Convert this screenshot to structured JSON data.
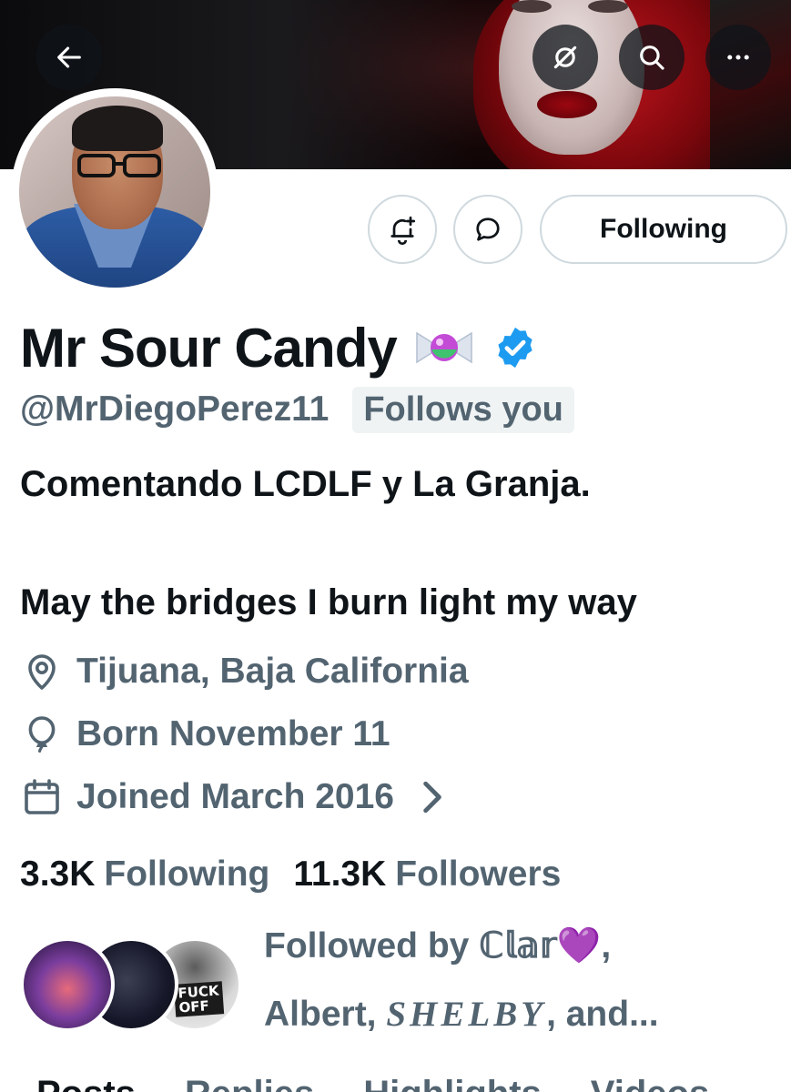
{
  "header": {
    "back_icon": "arrow-left-icon",
    "grok_icon": "grok-slash-icon",
    "search_icon": "search-icon",
    "more_icon": "more-horizontal-icon"
  },
  "actions": {
    "notify_icon": "bell-plus-icon",
    "message_icon": "message-bubble-icon",
    "following_label": "Following"
  },
  "profile": {
    "name": "Mr Sour Candy",
    "name_emoji": "candy-emoji",
    "verified_icon": "verified-badge-icon",
    "handle": "@MrDiegoPerez11",
    "follows_you": "Follows you",
    "bio_line1": "Comentando LCDLF y La Granja.",
    "bio_line2": "May the bridges I burn light my way",
    "location": "Tijuana, Baja California",
    "birthday": "Born November 11",
    "joined": "Joined March 2016",
    "following_count": "3.3K",
    "following_label": "Following",
    "followers_count": "11.3K",
    "followers_label": "Followers"
  },
  "followed_by": {
    "prefix": "Followed by ",
    "name1": "ℂ𝕝𝕒𝕣",
    "heart": "💜",
    "comma1": ",",
    "name2": "Albert, ",
    "name3": "SHELBY",
    "suffix": ", and...",
    "avatar3_text_line1": "FUCK",
    "avatar3_text_line2": "OFF"
  },
  "tabs": [
    "Posts",
    "Replies",
    "Highlights",
    "Videos"
  ],
  "colors": {
    "text_primary": "#0f1419",
    "text_secondary": "#536471",
    "verified_blue": "#1d9bf0",
    "border": "#cfd9de",
    "badge_bg": "#eff3f4"
  }
}
